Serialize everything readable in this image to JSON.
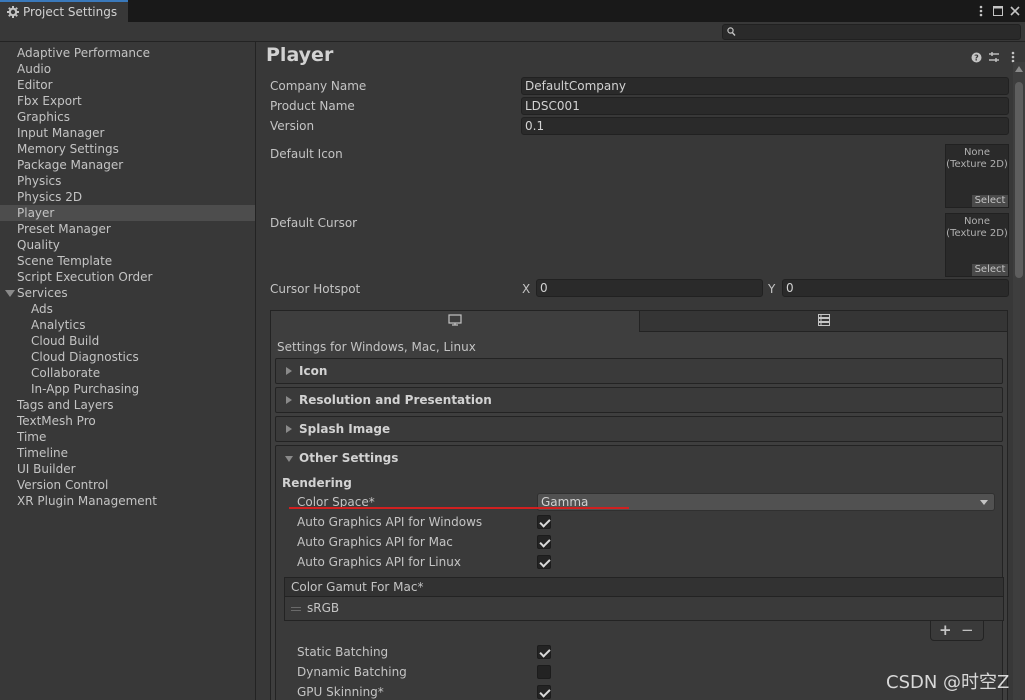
{
  "window": {
    "tab_title": "Project Settings"
  },
  "search": {
    "placeholder": ""
  },
  "sidebar": {
    "items": [
      {
        "label": "Adaptive Performance"
      },
      {
        "label": "Audio"
      },
      {
        "label": "Editor"
      },
      {
        "label": "Fbx Export"
      },
      {
        "label": "Graphics"
      },
      {
        "label": "Input Manager"
      },
      {
        "label": "Memory Settings"
      },
      {
        "label": "Package Manager"
      },
      {
        "label": "Physics"
      },
      {
        "label": "Physics 2D"
      },
      {
        "label": "Player",
        "selected": true
      },
      {
        "label": "Preset Manager"
      },
      {
        "label": "Quality"
      },
      {
        "label": "Scene Template"
      },
      {
        "label": "Script Execution Order"
      },
      {
        "label": "Services",
        "expanded": true
      },
      {
        "label": "Ads",
        "child": true
      },
      {
        "label": "Analytics",
        "child": true
      },
      {
        "label": "Cloud Build",
        "child": true
      },
      {
        "label": "Cloud Diagnostics",
        "child": true
      },
      {
        "label": "Collaborate",
        "child": true
      },
      {
        "label": "In-App Purchasing",
        "child": true
      },
      {
        "label": "Tags and Layers"
      },
      {
        "label": "TextMesh Pro"
      },
      {
        "label": "Time"
      },
      {
        "label": "Timeline"
      },
      {
        "label": "UI Builder"
      },
      {
        "label": "Version Control"
      },
      {
        "label": "XR Plugin Management"
      }
    ]
  },
  "player": {
    "title": "Player",
    "company_name": {
      "label": "Company Name",
      "value": "DefaultCompany"
    },
    "product_name": {
      "label": "Product Name",
      "value": "LDSC001"
    },
    "version": {
      "label": "Version",
      "value": "0.1"
    },
    "default_icon": {
      "label": "Default Icon",
      "none_text_1": "None",
      "none_text_2": "(Texture 2D)",
      "select": "Select"
    },
    "default_cursor": {
      "label": "Default Cursor",
      "none_text_1": "None",
      "none_text_2": "(Texture 2D)",
      "select": "Select"
    },
    "cursor_hotspot": {
      "label": "Cursor Hotspot",
      "x_label": "X",
      "x_value": "0",
      "y_label": "Y",
      "y_value": "0"
    }
  },
  "platform": {
    "settings_for": "Settings for Windows, Mac, Linux",
    "tabs": [
      {
        "icon": "monitor-icon",
        "active": true
      },
      {
        "icon": "server-icon",
        "active": false
      }
    ],
    "sections": [
      {
        "label": "Icon"
      },
      {
        "label": "Resolution and Presentation"
      },
      {
        "label": "Splash Image"
      },
      {
        "label": "Other Settings"
      }
    ],
    "other": {
      "rendering": "Rendering",
      "color_space": {
        "label": "Color Space*",
        "value": "Gamma"
      },
      "auto_api_windows": {
        "label": "Auto Graphics API  for Windows",
        "checked": true
      },
      "auto_api_mac": {
        "label": "Auto Graphics API  for Mac",
        "checked": true
      },
      "auto_api_linux": {
        "label": "Auto Graphics API  for Linux",
        "checked": true
      },
      "color_gamut_header": "Color Gamut For Mac*",
      "color_gamut_items": [
        "sRGB"
      ],
      "plus": "+",
      "minus": "−",
      "static_batching": {
        "label": "Static Batching",
        "checked": true
      },
      "dynamic_batching": {
        "label": "Dynamic Batching",
        "checked": false
      },
      "gpu_skinning": {
        "label": "GPU Skinning*",
        "checked": true
      }
    }
  },
  "watermark": "CSDN @时空Z"
}
